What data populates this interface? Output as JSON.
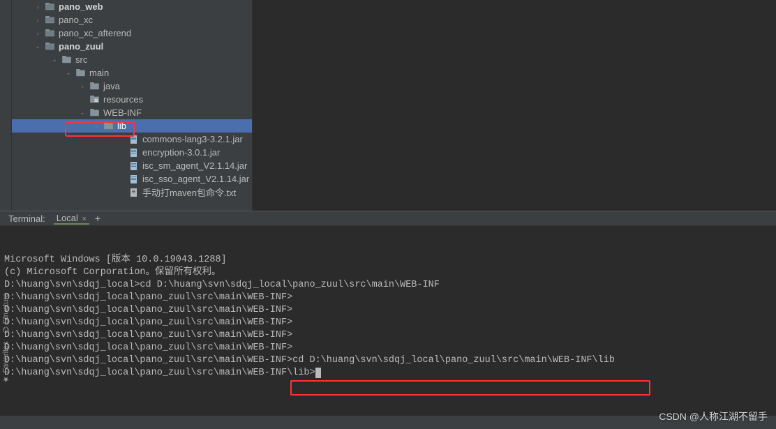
{
  "tree": {
    "items": [
      {
        "indent": 30,
        "expander": "›",
        "icon": "module",
        "label": "pano_web",
        "bold": true
      },
      {
        "indent": 30,
        "expander": "›",
        "icon": "module",
        "label": "pano_xc",
        "bold": false
      },
      {
        "indent": 30,
        "expander": "›",
        "icon": "module",
        "label": "pano_xc_afterend",
        "bold": false
      },
      {
        "indent": 30,
        "expander": "⌄",
        "icon": "module",
        "label": "pano_zuul",
        "bold": true
      },
      {
        "indent": 54,
        "expander": "⌄",
        "icon": "folder",
        "label": "src",
        "bold": false
      },
      {
        "indent": 74,
        "expander": "⌄",
        "icon": "folder",
        "label": "main",
        "bold": false
      },
      {
        "indent": 94,
        "expander": "›",
        "icon": "folder",
        "label": "java",
        "bold": false
      },
      {
        "indent": 94,
        "expander": "",
        "icon": "resources",
        "label": "resources",
        "bold": false
      },
      {
        "indent": 94,
        "expander": "⌄",
        "icon": "folder",
        "label": "WEB-INF",
        "bold": false
      },
      {
        "indent": 114,
        "expander": "⌄",
        "icon": "folder",
        "label": "lib",
        "bold": false,
        "selected": true
      },
      {
        "indent": 150,
        "expander": "",
        "icon": "jar",
        "label": "commons-lang3-3.2.1.jar",
        "bold": false
      },
      {
        "indent": 150,
        "expander": "",
        "icon": "jar",
        "label": "encryption-3.0.1.jar",
        "bold": false
      },
      {
        "indent": 150,
        "expander": "",
        "icon": "jar",
        "label": "isc_sm_agent_V2.1.14.jar",
        "bold": false
      },
      {
        "indent": 150,
        "expander": "",
        "icon": "jar",
        "label": "isc_sso_agent_V2.1.14.jar",
        "bold": false
      },
      {
        "indent": 150,
        "expander": "",
        "icon": "txt",
        "label": "手动打maven包命令.txt",
        "bold": false
      }
    ]
  },
  "terminal": {
    "tab_label": "Terminal:",
    "tab_active": "Local",
    "lines": [
      "Microsoft Windows [版本 10.0.19043.1288]",
      "(c) Microsoft Corporation。保留所有权利。",
      "",
      "D:\\huang\\svn\\sdqj_local>cd D:\\huang\\svn\\sdqj_local\\pano_zuul\\src\\main\\WEB-INF",
      "",
      "D:\\huang\\svn\\sdqj_local\\pano_zuul\\src\\main\\WEB-INF>",
      "D:\\huang\\svn\\sdqj_local\\pano_zuul\\src\\main\\WEB-INF>",
      "D:\\huang\\svn\\sdqj_local\\pano_zuul\\src\\main\\WEB-INF>",
      "D:\\huang\\svn\\sdqj_local\\pano_zuul\\src\\main\\WEB-INF>",
      "D:\\huang\\svn\\sdqj_local\\pano_zuul\\src\\main\\WEB-INF>",
      "D:\\huang\\svn\\sdqj_local\\pano_zuul\\src\\main\\WEB-INF>cd D:\\huang\\svn\\sdqj_local\\pano_zuul\\src\\main\\WEB-INF\\lib",
      "",
      "D:\\huang\\svn\\sdqj_local\\pano_zuul\\src\\main\\WEB-INF\\lib>"
    ]
  },
  "left_tools": {
    "structure": "Structure",
    "favorites": "Favorites"
  },
  "watermark": {
    "prefix": "CSDN ",
    "at": "@",
    "name": "人称江湖不留手"
  }
}
